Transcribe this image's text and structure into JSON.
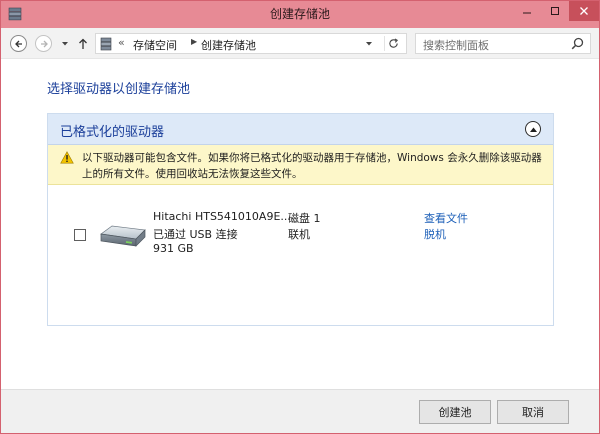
{
  "window": {
    "title": "创建存储池"
  },
  "nav": {
    "breadcrumb_separator": "«",
    "breadcrumbs": [
      "存储空间",
      "创建存储池"
    ],
    "search_placeholder": "搜索控制面板"
  },
  "content": {
    "heading": "选择驱动器以创建存储池",
    "panel": {
      "title": "已格式化的驱动器",
      "warning": "以下驱动器可能包含文件。如果你将已格式化的驱动器用于存储池，Windows 会永久删除该驱动器上的所有文件。使用回收站无法恢复这些文件。",
      "drives": [
        {
          "name": "Hitachi HTS541010A9E...",
          "connection": "已通过 USB 连接",
          "size": "931 GB",
          "disk": "磁盘 1",
          "status": "联机",
          "checked": false,
          "link_view": "查看文件",
          "link_offline": "脱机"
        }
      ]
    }
  },
  "footer": {
    "create_label": "创建池",
    "cancel_label": "取消"
  },
  "colors": {
    "titlebar": "#e78a95",
    "accent_text": "#1b3f9a",
    "link": "#1c5fb8",
    "warning_bg": "#fdf7c9"
  }
}
